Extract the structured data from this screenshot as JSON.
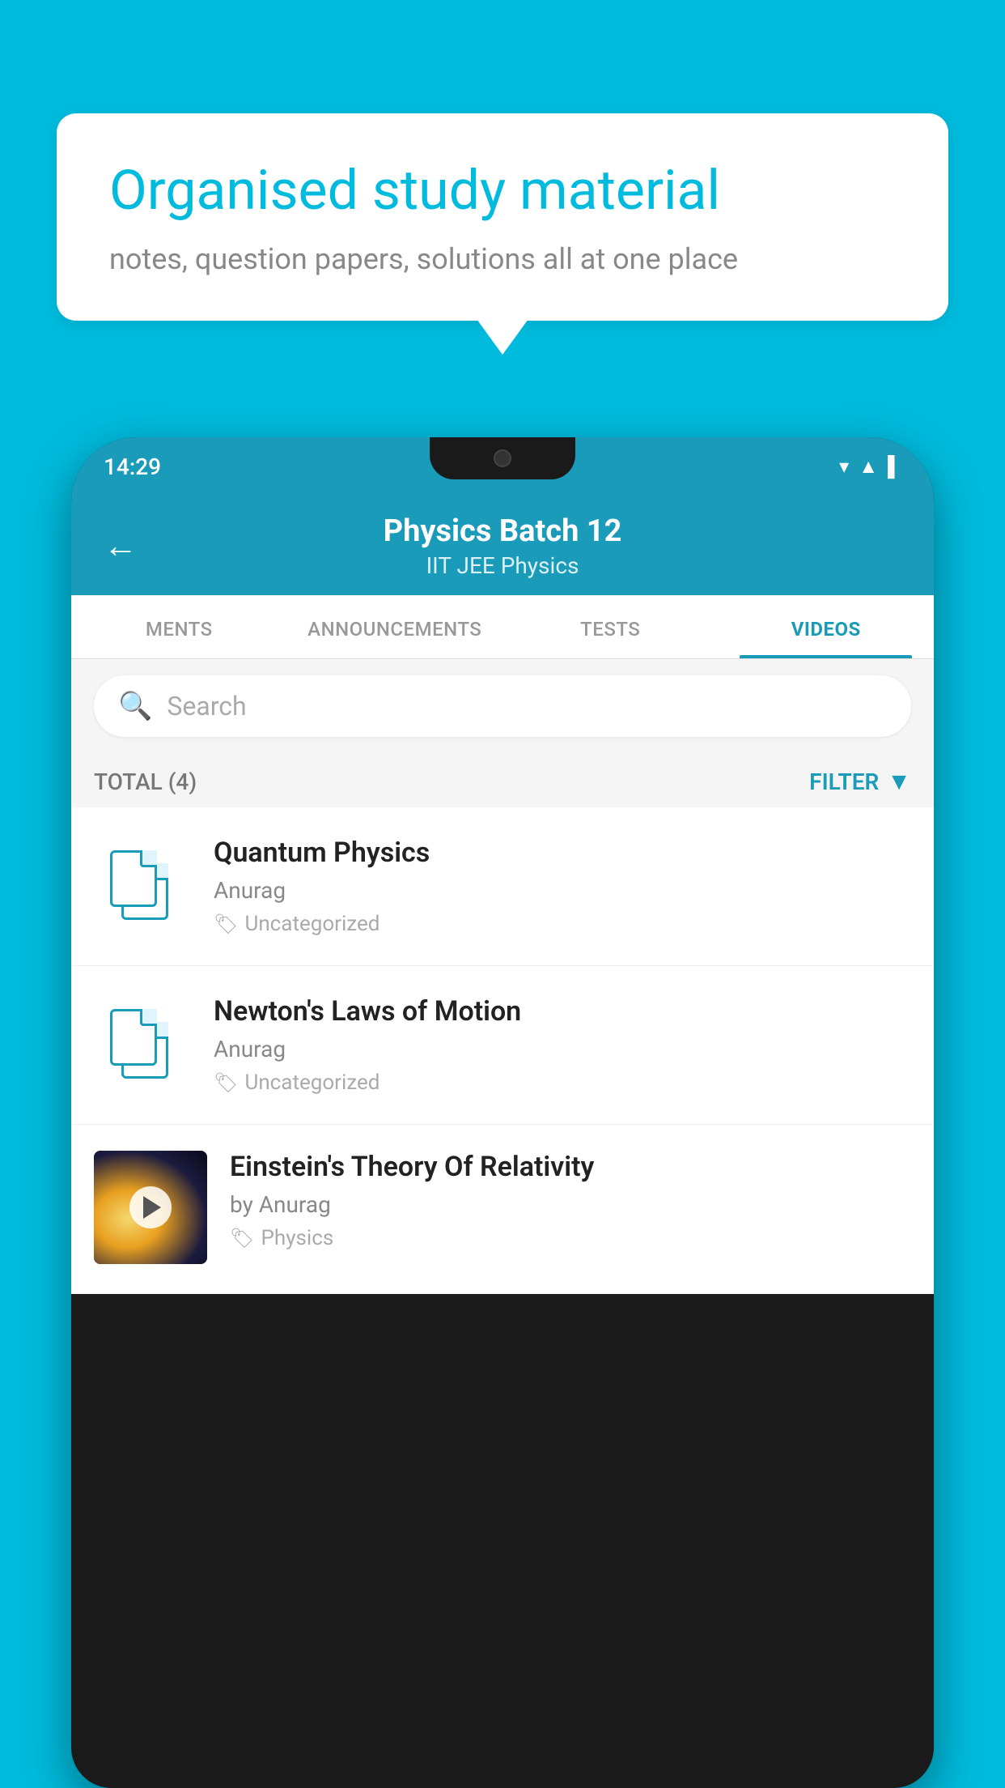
{
  "background_color": "#00BBDD",
  "speech_bubble": {
    "heading": "Organised study material",
    "subtext": "notes, question papers, solutions all at one place"
  },
  "status_bar": {
    "time": "14:29",
    "icons": [
      "wifi",
      "signal",
      "battery"
    ]
  },
  "header": {
    "title": "Physics Batch 12",
    "subtitle": "IIT JEE   Physics",
    "back_label": "←"
  },
  "tabs": [
    {
      "label": "MENTS",
      "active": false
    },
    {
      "label": "ANNOUNCEMENTS",
      "active": false
    },
    {
      "label": "TESTS",
      "active": false
    },
    {
      "label": "VIDEOS",
      "active": true
    }
  ],
  "search": {
    "placeholder": "Search"
  },
  "filter_row": {
    "total_label": "TOTAL (4)",
    "filter_label": "FILTER"
  },
  "videos": [
    {
      "title": "Quantum Physics",
      "author": "Anurag",
      "tag": "Uncategorized",
      "has_thumb": false
    },
    {
      "title": "Newton's Laws of Motion",
      "author": "Anurag",
      "tag": "Uncategorized",
      "has_thumb": false
    },
    {
      "title": "Einstein's Theory Of Relativity",
      "author": "by Anurag",
      "tag": "Physics",
      "has_thumb": true
    }
  ]
}
